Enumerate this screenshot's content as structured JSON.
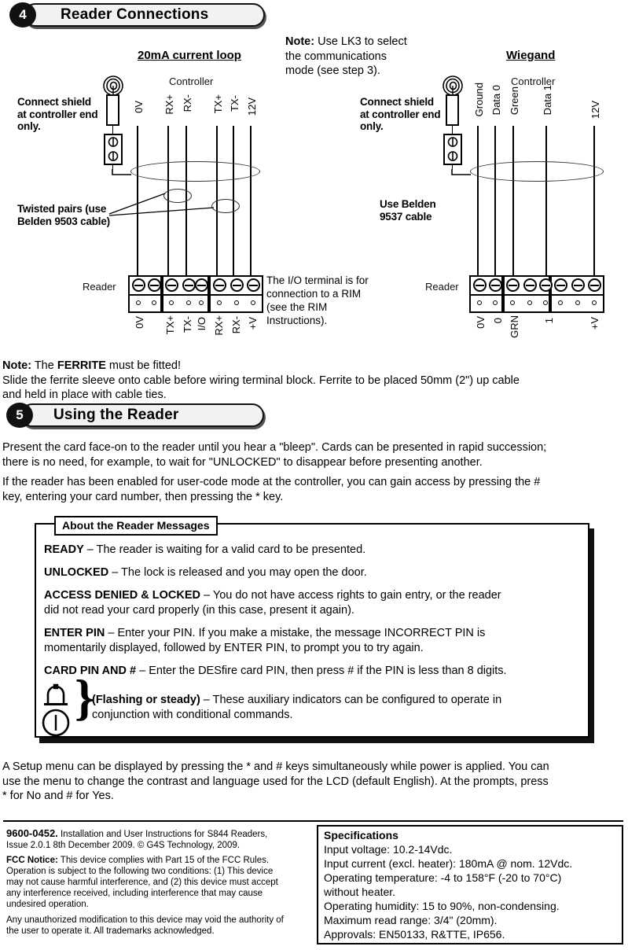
{
  "steps": [
    {
      "number": "4",
      "title": "Reader Connections"
    },
    {
      "number": "5",
      "title": "Using the Reader"
    }
  ],
  "diagrams": {
    "left": {
      "heading": "20mA current loop",
      "controller_label": "Controller",
      "reader_label": "Reader",
      "shield_note": "Connect shield\nat controller end\nonly.",
      "shield_note_lines": [
        "Connect shield",
        "at controller end",
        "only."
      ],
      "cable_note_lines": [
        "Twisted pairs (use",
        "Belden 9503 cable)"
      ],
      "controller_terminals": [
        "0V",
        "RX+",
        "RX-",
        "TX+",
        "TX-",
        "12V"
      ],
      "reader_terminals": [
        "0V",
        "TX+",
        "TX-",
        "I/O",
        "RX+",
        "RX-",
        "+V"
      ]
    },
    "right": {
      "heading": "Wiegand",
      "controller_label": "Controller",
      "reader_label": "Reader",
      "shield_note_lines": [
        "Connect shield",
        "at controller end",
        "only."
      ],
      "cable_note_lines": [
        "Use Belden",
        "9537 cable"
      ],
      "controller_terminals": [
        "Ground",
        "Data 0",
        "Green",
        "Data 1",
        "12V"
      ],
      "reader_terminals": [
        "0V",
        "0",
        "GRN",
        "1",
        "+V"
      ]
    }
  },
  "notes": {
    "lk3_lines": [
      "Note: Use LK3 to select",
      "the communications",
      "mode (see step 3)."
    ],
    "lk3_bold": "Note:",
    "io_terminal_lines": [
      "The I/O terminal is for",
      "connection to a RIM",
      "(see the RIM",
      "Instructions)."
    ],
    "ferrite_label": "Note:",
    "ferrite_line1_a": " The ",
    "ferrite_line1_b": "FERRITE",
    "ferrite_line1_c": " must be fitted!",
    "ferrite_line2": "Slide the ferrite sleeve onto cable before wiring terminal block.  Ferrite to be placed 50mm (2\") up cable",
    "ferrite_line3": "and held in place with cable ties."
  },
  "using_reader": {
    "para1_line1": "Present the card face-on to the reader until you hear a \"bleep\". Cards can be presented in rapid succession;",
    "para1_line2": "there is no need, for example, to wait for \"UNLOCKED\" to disappear before presenting another.",
    "para2_line1": "If the reader has been enabled for user-code mode at the controller, you can gain access by pressing the #",
    "para2_line2": "key, entering your card number, then pressing the * key."
  },
  "messages_box": {
    "title": "About the Reader Messages",
    "entries": [
      {
        "term": "READY",
        "dash": " – ",
        "lines": [
          "The reader is waiting for a valid card to be presented."
        ]
      },
      {
        "term": "UNLOCKED",
        "dash": " – ",
        "lines": [
          "The lock is released and you may open the door."
        ]
      },
      {
        "term": "ACCESS DENIED & LOCKED",
        "dash": " – ",
        "lines": [
          "You do not have access rights to gain entry, or the reader",
          "did not read your card properly (in this case, present it again)."
        ]
      },
      {
        "term": "ENTER PIN",
        "dash": " – ",
        "lines": [
          "Enter your PIN. If you make a mistake, the message INCORRECT PIN is",
          "momentarily displayed, followed by ENTER PIN, to prompt you to try again."
        ]
      },
      {
        "term": "CARD PIN AND #",
        "dash": " – ",
        "lines": [
          "Enter the DESfire card PIN, then press # if the PIN is less than 8 digits."
        ]
      }
    ],
    "aux": {
      "term": "(Flashing or steady)",
      "dash": " – ",
      "line1": "These auxiliary indicators can be configured to operate in",
      "line2": "conjunction with conditional commands.",
      "icon1": "bell-icon",
      "icon2": "beacon-icon",
      "brace": "}"
    }
  },
  "setup_menu": {
    "line1": "A Setup menu can be displayed by pressing the * and # keys simultaneously while power is applied. You can",
    "line2": "use the menu to change the contrast and language used for the LCD (default English). At the prompts, press",
    "line3": "* for No and # for Yes."
  },
  "footer": {
    "doc_number": "9600-0452.",
    "doc_title_line1": " Installation and User Instructions for S844 Readers,",
    "doc_title_line2": "Issue 2.0.1 8th December 2009. © G4S Technology, 2009.",
    "fcc_label": "FCC Notice:",
    "fcc_lines": [
      " This device complies with Part 15 of the FCC Rules.",
      "Operation is subject to the following two conditions: (1) This device",
      "may not cause harmful interference, and (2) this device must accept",
      "any interference received, including interference that may cause",
      "undesired operation."
    ],
    "mod_lines": [
      "Any unauthorized modification to this device may void the authority of",
      "the user to operate it. All trademarks acknowledged."
    ]
  },
  "specifications": {
    "title": "Specifications",
    "lines": [
      "Input voltage: 10.2-14Vdc.",
      "Input current (excl. heater): 180mA @ nom. 12Vdc.",
      "Operating temperature: -4 to 158°F (-20 to 70°C)",
      "without heater.",
      "Operating humidity: 15 to 90%, non-condensing.",
      "Maximum read range: 3/4\" (20mm).",
      "Approvals: EN50133, R&TTE, IP656."
    ]
  },
  "colors": {
    "bar_fill": "#f2f2f2",
    "ink": "#111111",
    "shadow": "#555555"
  }
}
